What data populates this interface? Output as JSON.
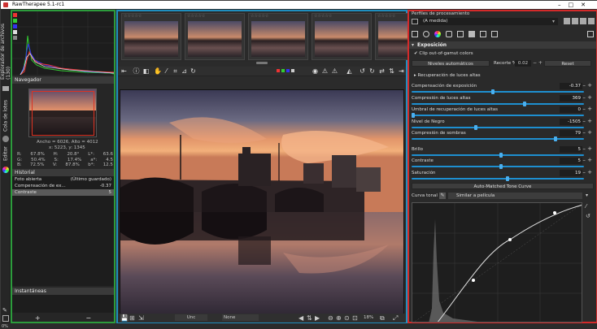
{
  "window": {
    "title": "RawTherapee 5.1-rc1",
    "controls": "–□✕"
  },
  "left_tabs": {
    "file_browser": "Explorador de archivos (130)",
    "queue": "Cola de lotes",
    "editor": "Editor"
  },
  "navigator": {
    "header": "Navegador",
    "size_line": "Ancho = 6026, Alto = 4012",
    "coords_line": "x: 5223, y: 1345",
    "readout": [
      [
        "R:",
        "67.8%",
        "H:",
        "20.8°",
        "L*:",
        "63.6"
      ],
      [
        "G:",
        "50.4%",
        "S:",
        "17.4%",
        "a*:",
        "4.5"
      ],
      [
        "B:",
        "72.5%",
        "V:",
        "87.8%",
        "b*:",
        "12.5"
      ]
    ]
  },
  "history": {
    "header": "Historial",
    "items": [
      {
        "label": "Foto abierta",
        "value": "(Último guardado)"
      },
      {
        "label": "Compensación de ex...",
        "value": "-0.37"
      },
      {
        "label": "Contraste",
        "value": "5"
      }
    ]
  },
  "snapshots": {
    "header": "Instantáneas",
    "add": "+",
    "remove": "−"
  },
  "filmstrip": {
    "stars": "☆☆☆☆☆",
    "count": 5
  },
  "bottom_bar": {
    "profile_label": "Unc",
    "preset": "None",
    "zoom": "18%"
  },
  "right_panel": {
    "profile_header": "Perfiles de procesamiento",
    "profile_value": "(A medida)",
    "section": "Exposición",
    "clip": "Clip out-of-gamut colors",
    "auto_levels": "Niveles automáticos",
    "clip_pct_label": "Recorte %",
    "clip_pct_value": "0.02",
    "reset": "Reset",
    "highlight_recovery": "Recuperación de luces altas",
    "rows": [
      {
        "label": "Compensación de exposición",
        "value": "-0.37"
      },
      {
        "label": "Compresión de luces altas",
        "value": "369"
      },
      {
        "label": "Umbral de recuperación de luces altas",
        "value": "0"
      },
      {
        "label": "Nivel de Negro",
        "value": "-1505"
      },
      {
        "label": "Compresión de sombras",
        "value": "79"
      },
      {
        "label": "Brillo",
        "value": "5"
      },
      {
        "label": "Contraste",
        "value": "5"
      },
      {
        "label": "Saturación",
        "value": "19"
      }
    ],
    "tone_curve_button": "Auto-Matched Tone Curve",
    "curve_label": "Curva tonal 1:",
    "curve_type": "Similar a película"
  },
  "colors": {
    "left_border": "#2c9c3c",
    "center_border": "#1f8fbf",
    "right_border": "#d42a2a",
    "slider": "#1e8fd0"
  }
}
